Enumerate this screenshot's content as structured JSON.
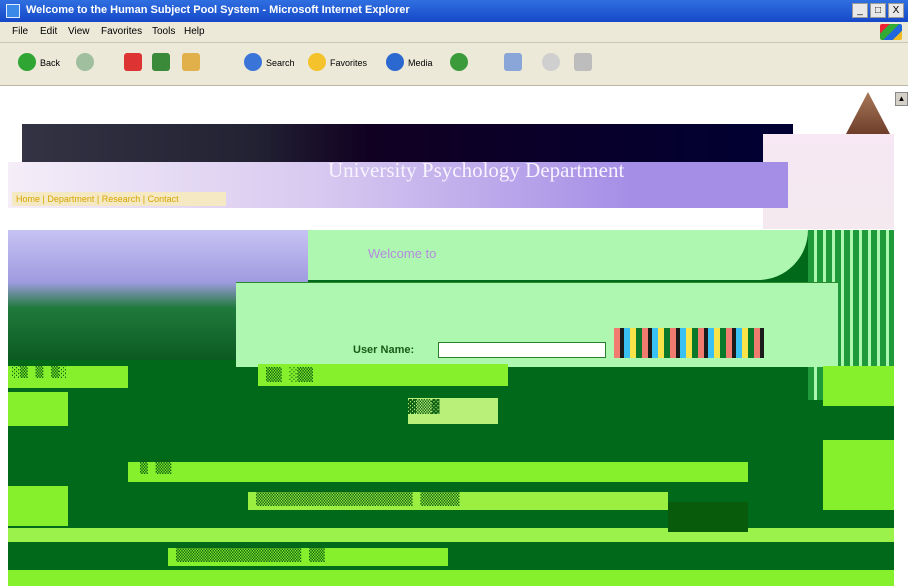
{
  "window": {
    "title": "Welcome to the Human Subject Pool System - Microsoft Internet Explorer",
    "controls": [
      "_",
      "□",
      "X"
    ]
  },
  "menu": [
    "File",
    "Edit",
    "View",
    "Favorites",
    "Tools",
    "Help"
  ],
  "toolbar": {
    "back_label": "Back",
    "search_label": "Search",
    "favorites_label": "Favorites",
    "media_label": "Media"
  },
  "page": {
    "header_title": "University Psychology Department",
    "nav_text": "Home | Department | Research | Contact",
    "welcome_text": "Welcome to",
    "login": {
      "username_label": "User Name:",
      "username_value": ""
    }
  }
}
